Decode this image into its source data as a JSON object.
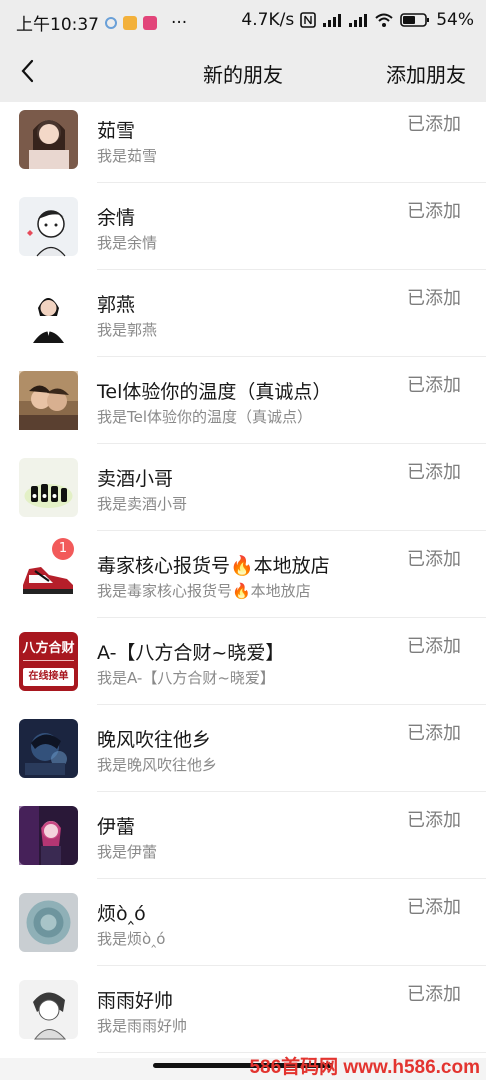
{
  "status_bar": {
    "time": "上午10:37",
    "more": "···",
    "speed": "4.7K/s",
    "battery": "54%"
  },
  "nav": {
    "title": "新的朋友",
    "action": "添加朋友"
  },
  "friends": [
    {
      "name": "茹雪",
      "message": "我是茹雪",
      "action": "已添加",
      "avatar": "photo-avatar"
    },
    {
      "name": "余情",
      "message": "我是余情",
      "action": "已添加",
      "avatar": "cartoon-avatar"
    },
    {
      "name": "郭燕",
      "message": "我是郭燕",
      "action": "已添加",
      "avatar": "portrait-avatar"
    },
    {
      "name": "Tel体验你的温度（真诚点）",
      "message": "我是Tel体验你的温度（真诚点）",
      "action": "已添加",
      "avatar": "couple-avatar"
    },
    {
      "name": "卖酒小哥",
      "message": "我是卖酒小哥",
      "action": "已添加",
      "avatar": "bottles-avatar"
    },
    {
      "name": "毒家核心报货号🔥本地放店",
      "message": "我是毒家核心报货号🔥本地放店",
      "action": "已添加",
      "avatar": "sneaker-avatar",
      "badge": "1"
    },
    {
      "name": "A-【八方合财~晓爱】",
      "message": "我是A-【八方合财~晓爱】",
      "action": "已添加",
      "avatar": "text-avatar",
      "avatar_text_top": "八方合财",
      "avatar_text_bottom": "在线接单"
    },
    {
      "name": "晚风吹往他乡",
      "message": "我是晚风吹往他乡",
      "action": "已添加",
      "avatar": "anime-avatar"
    },
    {
      "name": "伊蕾",
      "message": "我是伊蕾",
      "action": "已添加",
      "avatar": "neon-avatar"
    },
    {
      "name": "烦ò‸ó",
      "message": "我是烦ò‸ó",
      "action": "已添加",
      "avatar": "cup-avatar"
    },
    {
      "name": "雨雨好帅",
      "message": "我是雨雨好帅",
      "action": "已添加",
      "avatar": "sketch-avatar"
    }
  ],
  "watermark": "586首码网 www.h586.com",
  "colors": {
    "bar_bg": "#ededed",
    "badge": "#f25a5a",
    "muted": "#8a8a8a"
  }
}
